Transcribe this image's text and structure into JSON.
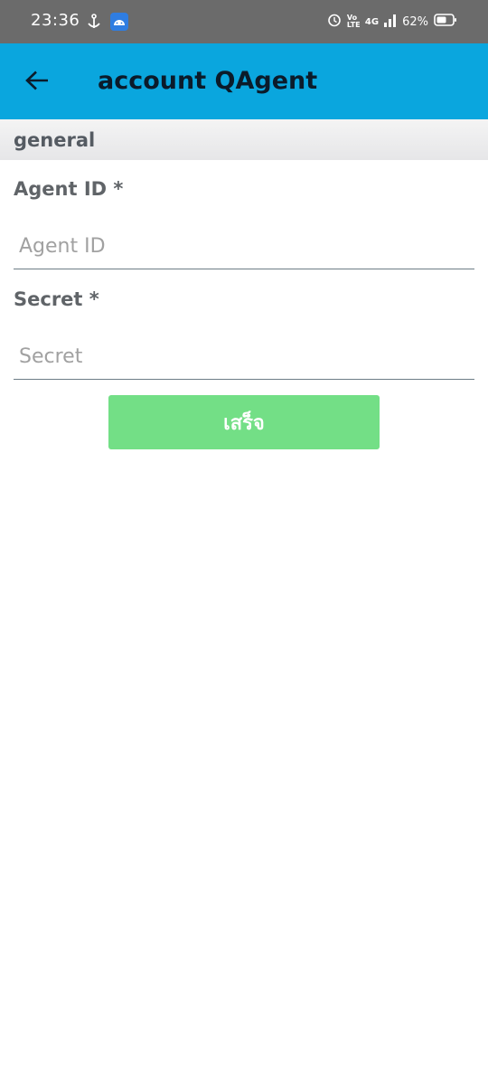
{
  "status_bar": {
    "time": "23:36",
    "battery_percent": "62%",
    "network_label": "4G",
    "volte_label": "Vo LTE"
  },
  "app_bar": {
    "title": "account QAgent"
  },
  "section": {
    "title": "general"
  },
  "form": {
    "agent_id": {
      "label": "Agent ID *",
      "placeholder": "Agent ID",
      "value": ""
    },
    "secret": {
      "label": "Secret *",
      "placeholder": "Secret",
      "value": ""
    },
    "submit_label": "เสร็จ"
  },
  "colors": {
    "status_bar": "#6b6b6b",
    "app_bar": "#0aa6de",
    "submit_button": "#73df86"
  }
}
